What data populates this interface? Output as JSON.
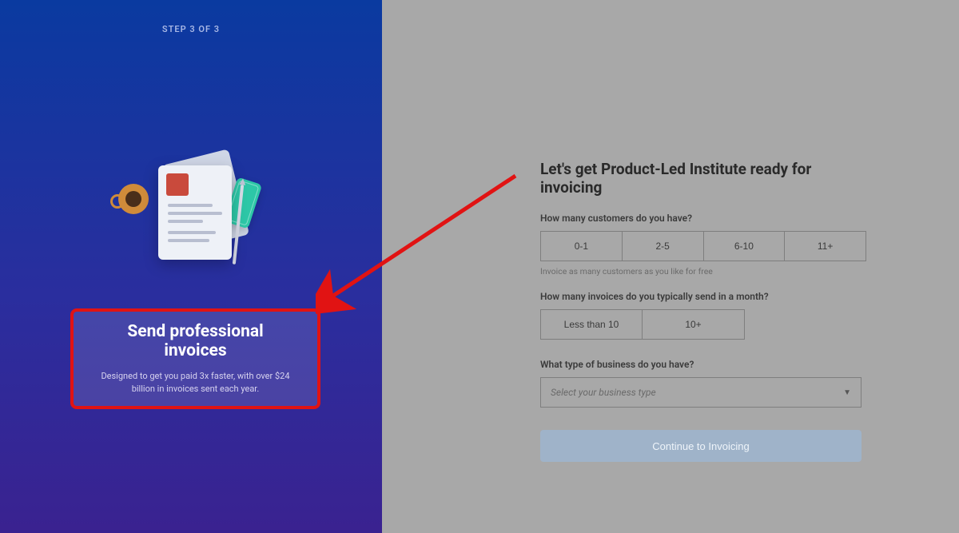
{
  "left": {
    "step": "STEP 3 OF 3",
    "highlight_title": "Send professional invoices",
    "highlight_desc": "Designed to get you paid 3x faster, with over $24 billion in invoices sent each year."
  },
  "form": {
    "heading": "Let's get Product-Led Institute ready for invoicing",
    "q_customers": "How many customers do you have?",
    "customers_options": [
      "0-1",
      "2-5",
      "6-10",
      "11+"
    ],
    "customers_hint": "Invoice as many customers as you like for free",
    "q_invoices": "How many invoices do you typically send in a month?",
    "invoices_options": [
      "Less than 10",
      "10+"
    ],
    "q_biztype": "What type of business do you have?",
    "biztype_placeholder": "Select your business type",
    "cta": "Continue to Invoicing"
  },
  "annotation": {
    "arrow_color": "#e11313"
  }
}
